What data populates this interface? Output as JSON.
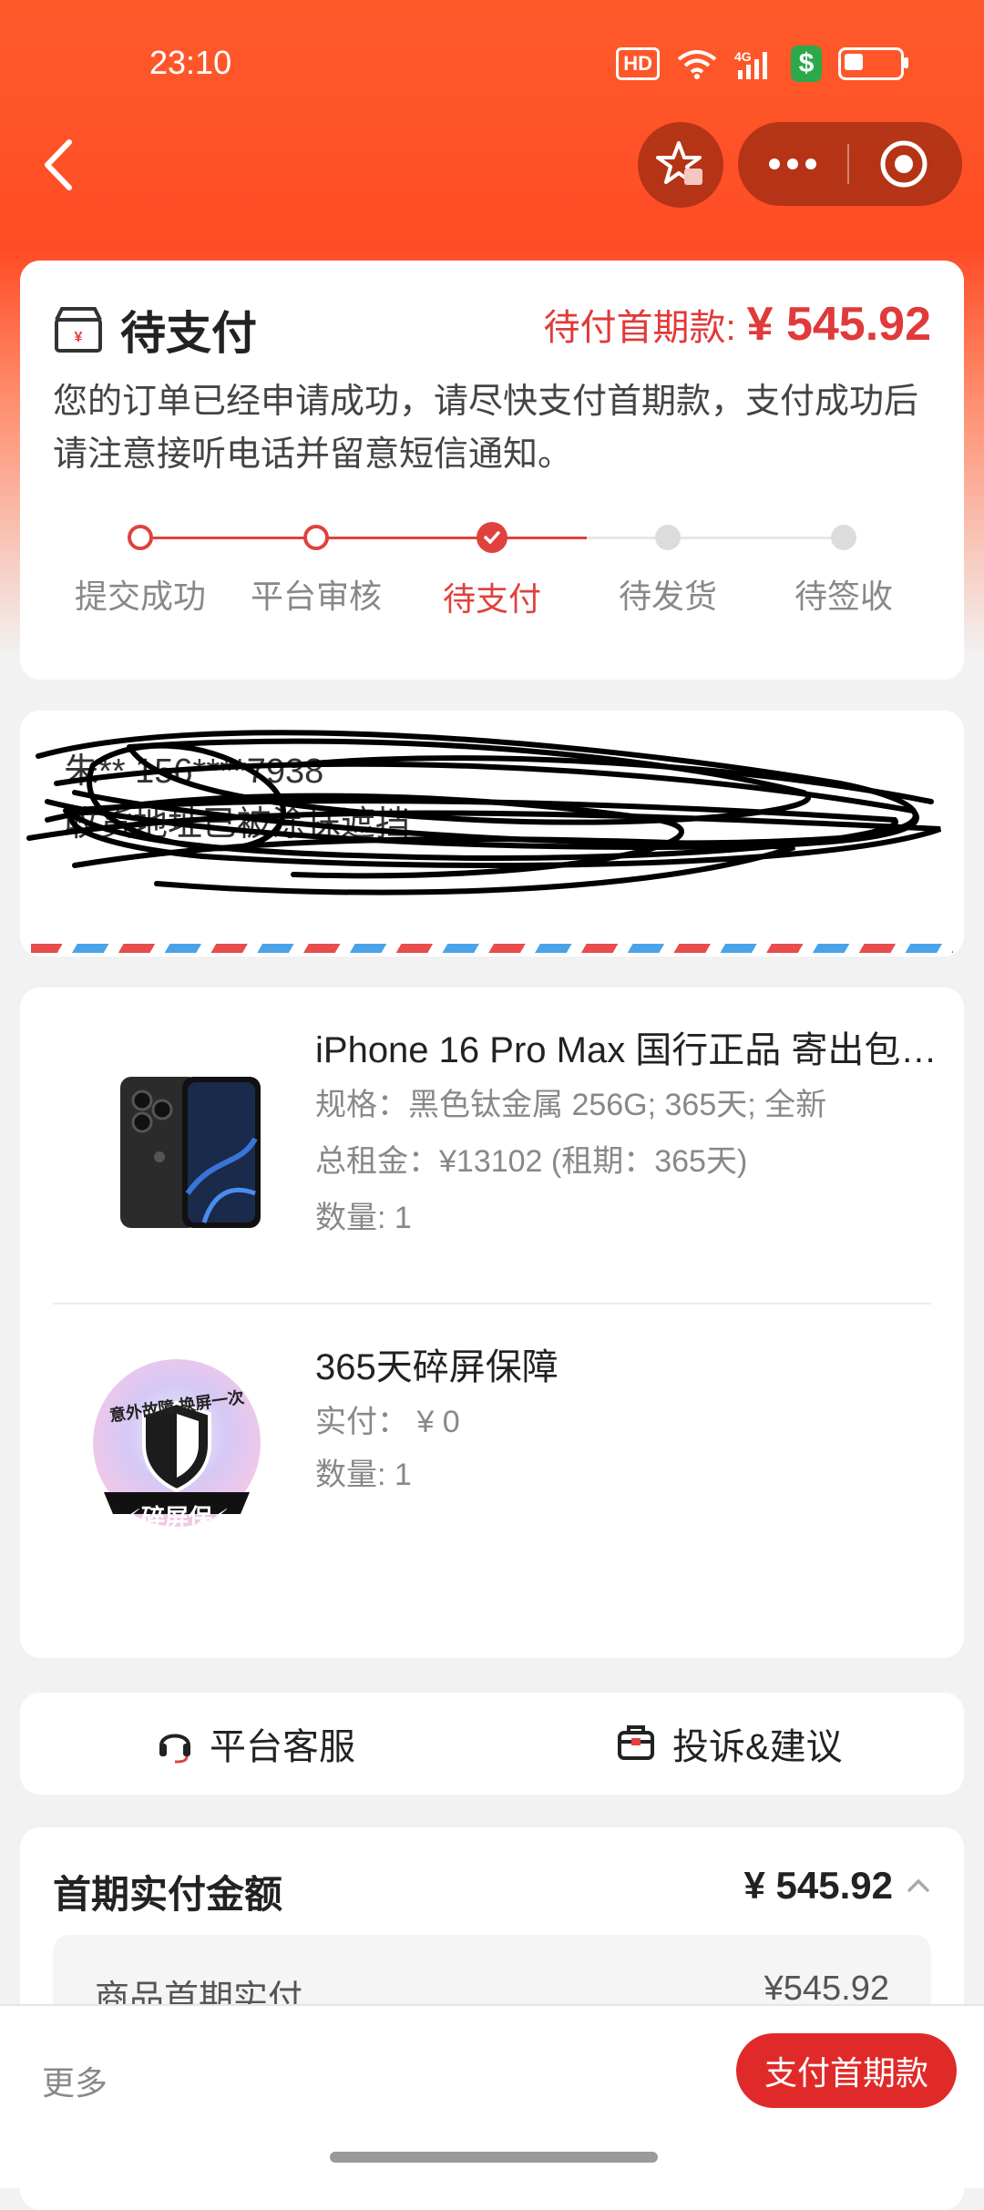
{
  "status_bar": {
    "time": "23:10",
    "hd": "HD",
    "net": "4G"
  },
  "nav": {
    "back_icon": "chevron-left-icon",
    "favorite_icon": "star-icon",
    "more_icon": "more-dots-icon",
    "target_icon": "target-icon"
  },
  "order_status": {
    "title": "待支付",
    "due_label": "待付首期款:",
    "due_value": "¥ 545.92",
    "description": "您的订单已经申请成功，请尽快支付首期款，支付成功后请注意接听电话并留意短信通知。",
    "steps": [
      {
        "label": "提交成功",
        "state": "done"
      },
      {
        "label": "平台审核",
        "state": "done"
      },
      {
        "label": "待支付",
        "state": "current"
      },
      {
        "label": "待发货",
        "state": "todo"
      },
      {
        "label": "待签收",
        "state": "todo"
      }
    ],
    "accent_color": "#e0413d"
  },
  "address": {
    "line1": "朱** 156****7938",
    "line2": "收货地址已被涂抹遮挡",
    "redacted": true
  },
  "products": [
    {
      "name": "iPhone 16 Pro Max 国行正品 寄出包…",
      "spec": "规格：黑色钛金属 256G; 365天; 全新",
      "total": "总租金：¥13102 (租期：365天)",
      "qty": "数量: 1"
    },
    {
      "name": "365天碎屏保障",
      "paid": "实付：  ¥ 0",
      "qty": "数量: 1",
      "badge_top": "意外故障 换屏一次",
      "badge_bottom": "⚡碎屏保⚡"
    }
  ],
  "services": {
    "support": "平台客服",
    "feedback": "投诉&建议"
  },
  "payment": {
    "title": "首期实付金额",
    "total": "¥ 545.92",
    "detail_label": "商品首期实付",
    "detail_value": "¥545.92"
  },
  "bottom": {
    "more": "更多",
    "pay_button": "支付首期款"
  }
}
